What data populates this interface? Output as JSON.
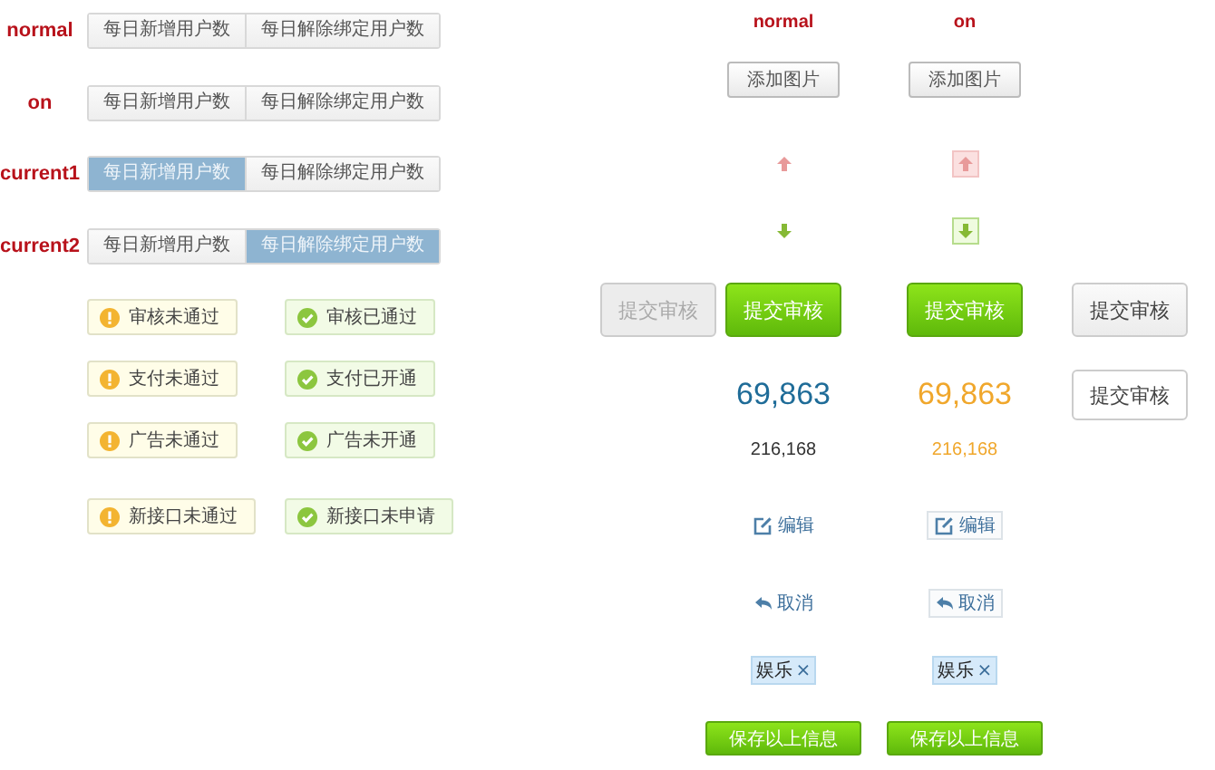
{
  "tab_rows": [
    {
      "label": "normal",
      "tabs": [
        {
          "label": "每日新增用户数",
          "selected": false
        },
        {
          "label": "每日解除绑定用户数",
          "selected": false
        }
      ]
    },
    {
      "label": "on",
      "tabs": [
        {
          "label": "每日新增用户数",
          "selected": false
        },
        {
          "label": "每日解除绑定用户数",
          "selected": false
        }
      ]
    },
    {
      "label": "current1",
      "tabs": [
        {
          "label": "每日新增用户数",
          "selected": true
        },
        {
          "label": "每日解除绑定用户数",
          "selected": false
        }
      ]
    },
    {
      "label": "current2",
      "tabs": [
        {
          "label": "每日新增用户数",
          "selected": false
        },
        {
          "label": "每日解除绑定用户数",
          "selected": true
        }
      ]
    }
  ],
  "status_badges": [
    [
      {
        "kind": "warning",
        "text": "审核未通过"
      },
      {
        "kind": "success",
        "text": "审核已通过"
      }
    ],
    [
      {
        "kind": "warning",
        "text": "支付未通过"
      },
      {
        "kind": "success",
        "text": "支付已开通"
      }
    ],
    [
      {
        "kind": "warning",
        "text": "广告未通过"
      },
      {
        "kind": "success",
        "text": "广告未开通"
      }
    ],
    [
      {
        "kind": "warning",
        "text": "新接口未通过"
      },
      {
        "kind": "success",
        "text": "新接口未申请"
      }
    ]
  ],
  "column_headers": [
    "normal",
    "on"
  ],
  "add_image_buttons": [
    {
      "label": "添加图片"
    },
    {
      "label": "添加图片"
    }
  ],
  "move_up_buttons": [
    {
      "hover": false
    },
    {
      "hover": true
    }
  ],
  "move_down_buttons": [
    {
      "hover": false
    },
    {
      "hover": true
    }
  ],
  "submit_buttons": [
    {
      "label": "提交审核",
      "kind": "disabled"
    },
    {
      "label": "提交审核",
      "kind": "primary"
    },
    {
      "label": "提交审核",
      "kind": "primary"
    },
    {
      "label": "提交审核",
      "kind": "secondary"
    },
    {
      "label": "提交审核",
      "kind": "outline"
    }
  ],
  "stats": [
    {
      "value": "69,863",
      "total": "216,168",
      "hover": false
    },
    {
      "value": "69,863",
      "total": "216,168",
      "hover": true
    }
  ],
  "edit_links": [
    {
      "label": "编辑",
      "hover": false
    },
    {
      "label": "编辑",
      "hover": true
    }
  ],
  "cancel_links": [
    {
      "label": "取消",
      "hover": false
    },
    {
      "label": "取消",
      "hover": true
    }
  ],
  "tags": [
    {
      "label": "娱乐",
      "remove": "×"
    },
    {
      "label": "娱乐",
      "remove": "×"
    }
  ],
  "save_buttons": [
    {
      "label": "保存以上信息"
    },
    {
      "label": "保存以上信息"
    }
  ]
}
